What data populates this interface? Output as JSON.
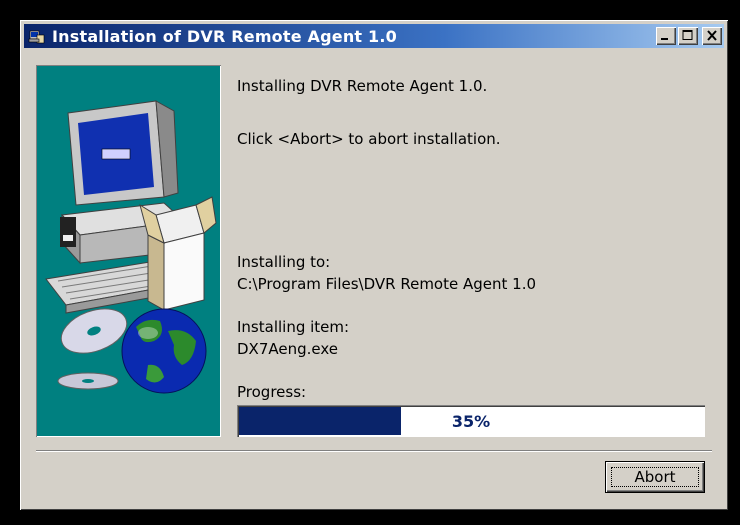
{
  "window": {
    "title": "Installation of DVR Remote Agent 1.0"
  },
  "content": {
    "installing_line": "Installing DVR Remote Agent 1.0.",
    "abort_hint": "Click <Abort> to abort installation.",
    "installing_to_label": "Installing to:",
    "installing_to_path": "C:\\Program Files\\DVR Remote Agent 1.0",
    "installing_item_label": "Installing item:",
    "installing_item_value": "DX7Aeng.exe",
    "progress_label": "Progress:",
    "progress_text": "35%",
    "progress_value": 0.35
  },
  "buttons": {
    "abort_label": "Abort"
  },
  "icons": {
    "app": "installer-icon",
    "minimize": "minimize-icon",
    "maximize": "maximize-icon",
    "close": "close-icon"
  },
  "colors": {
    "title_gradient_start": "#0a246a",
    "title_gradient_end": "#a6caf0",
    "sidebar_bg": "#008080",
    "progress_fill": "#0a246a",
    "window_bg": "#d4d0c8"
  }
}
